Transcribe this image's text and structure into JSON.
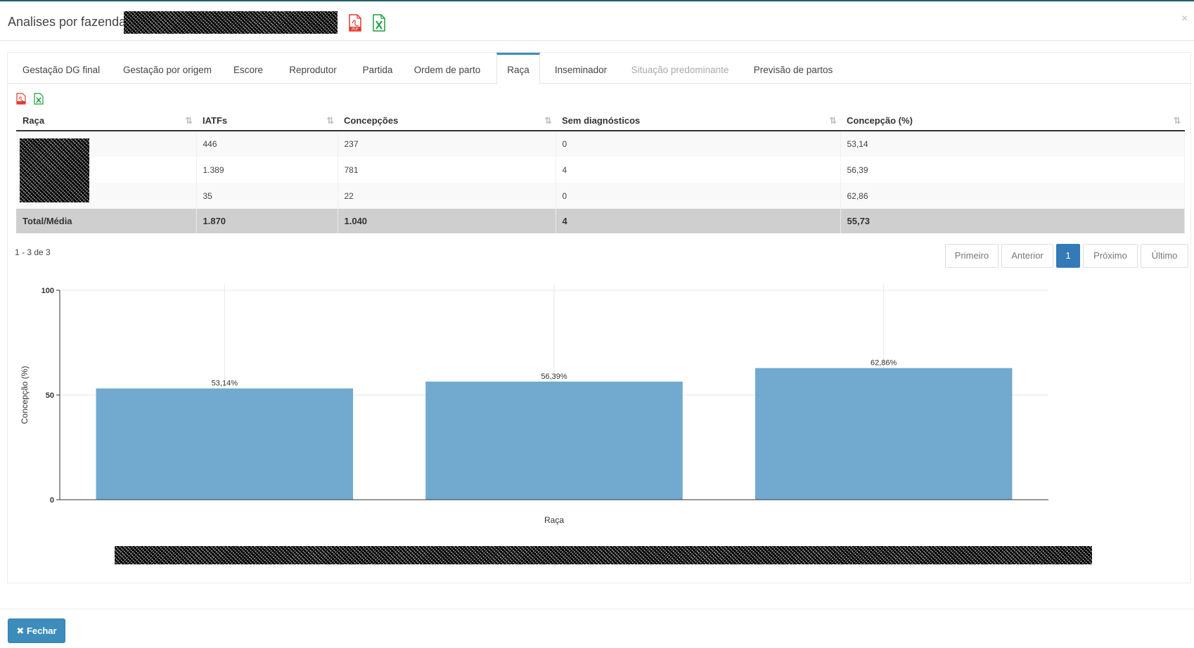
{
  "header": {
    "title": "Analises por fazendas",
    "pdf_icon": "pdf-file-icon",
    "excel_icon": "excel-file-icon",
    "close_label": "×"
  },
  "tabs": [
    {
      "label": "Gestação DG final"
    },
    {
      "label": "Gestação por origem"
    },
    {
      "label": "Escore"
    },
    {
      "label": "Reprodutor"
    },
    {
      "label": "Partida"
    },
    {
      "label": "Ordem de parto"
    },
    {
      "label": "Raça"
    },
    {
      "label": "Inseminador"
    },
    {
      "label": "Situação predominante"
    },
    {
      "label": "Previsão de partos"
    }
  ],
  "active_tab": "Raça",
  "table": {
    "columns": [
      "Raça",
      "IATFs",
      "Concepções",
      "Sem diagnósticos",
      "Concepção (%)"
    ],
    "sort_icon": "⇅",
    "rows": [
      {
        "raca": "",
        "iatfs": "446",
        "concepcoes": "237",
        "sem_diag": "0",
        "concepcao": "53,14"
      },
      {
        "raca": "",
        "iatfs": "1.389",
        "concepcoes": "781",
        "sem_diag": "4",
        "concepcao": "56,39"
      },
      {
        "raca": "",
        "iatfs": "35",
        "concepcoes": "22",
        "sem_diag": "0",
        "concepcao": "62,86"
      }
    ],
    "total": {
      "label": "Total/Média",
      "iatfs": "1.870",
      "concepcoes": "1.040",
      "sem_diag": "4",
      "concepcao": "55,73"
    }
  },
  "pagination": {
    "info": "1 - 3 de 3",
    "first": "Primeiro",
    "prev": "Anterior",
    "current": "1",
    "next": "Próximo",
    "last": "Último"
  },
  "chart_data": {
    "type": "bar",
    "categories": [
      "",
      "",
      ""
    ],
    "values": [
      53.14,
      56.39,
      62.86
    ],
    "data_labels": [
      "53,14%",
      "56,39%",
      "62,86%"
    ],
    "ylabel": "Concepção (%)",
    "xlabel": "Raça",
    "ylim": [
      0,
      100
    ],
    "yticks": [
      "0",
      "50",
      "100"
    ],
    "grid": true,
    "bar_color": "#72a9cf"
  },
  "footer": {
    "close_button": "Fechar",
    "close_icon": "times-icon"
  }
}
